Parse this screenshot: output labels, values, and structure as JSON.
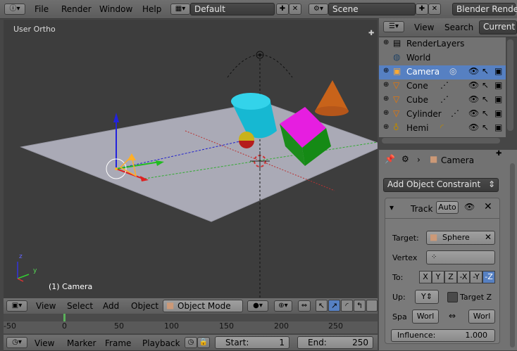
{
  "top_menu": {
    "items": [
      "File",
      "Render",
      "Window",
      "Help"
    ],
    "screen_layout": "Default",
    "scene": "Scene",
    "engine": "Blender Render"
  },
  "viewport": {
    "view_label": "User Ortho",
    "object_label": "(1) Camera",
    "axis_z": "z",
    "axis_y": "y"
  },
  "viewport_header": {
    "menus": [
      "View",
      "Select",
      "Add",
      "Object"
    ],
    "mode": "Object Mode"
  },
  "timeline": {
    "ruler_labels": [
      "-50",
      "0",
      "50",
      "100",
      "150",
      "200",
      "250"
    ],
    "menus": [
      "View",
      "Marker",
      "Frame",
      "Playback"
    ],
    "start_label": "Start:",
    "start_value": "1",
    "end_label": "End:",
    "end_value": "250"
  },
  "outliner": {
    "header_menus": [
      "View",
      "Search"
    ],
    "filter": "Current",
    "rows": [
      "RenderLayers",
      "World",
      "Camera",
      "Cone",
      "Cube",
      "Cylinder",
      "Hemi"
    ]
  },
  "properties": {
    "breadcrumb": "Camera",
    "add_constraint": "Add Object Constraint",
    "constraint": {
      "name": "Track",
      "auto_label": "Auto",
      "target_label": "Target:",
      "target_value": "Sphere",
      "vertex_label": "Vertex",
      "to_label": "To:",
      "to_axes": [
        "X",
        "Y",
        "Z",
        "-X",
        "-Y",
        "-Z"
      ],
      "to_selected": "-Z",
      "up_label": "Up:",
      "up_value": "Y",
      "target_z_label": "Target Z",
      "space_label": "Spa",
      "space_left": "Worl",
      "space_right": "Worl",
      "influence_label": "Influence:",
      "influence_value": "1.000"
    }
  },
  "colors": {
    "selected_blue": "#5680c2",
    "active_object": "#ffaf29"
  }
}
